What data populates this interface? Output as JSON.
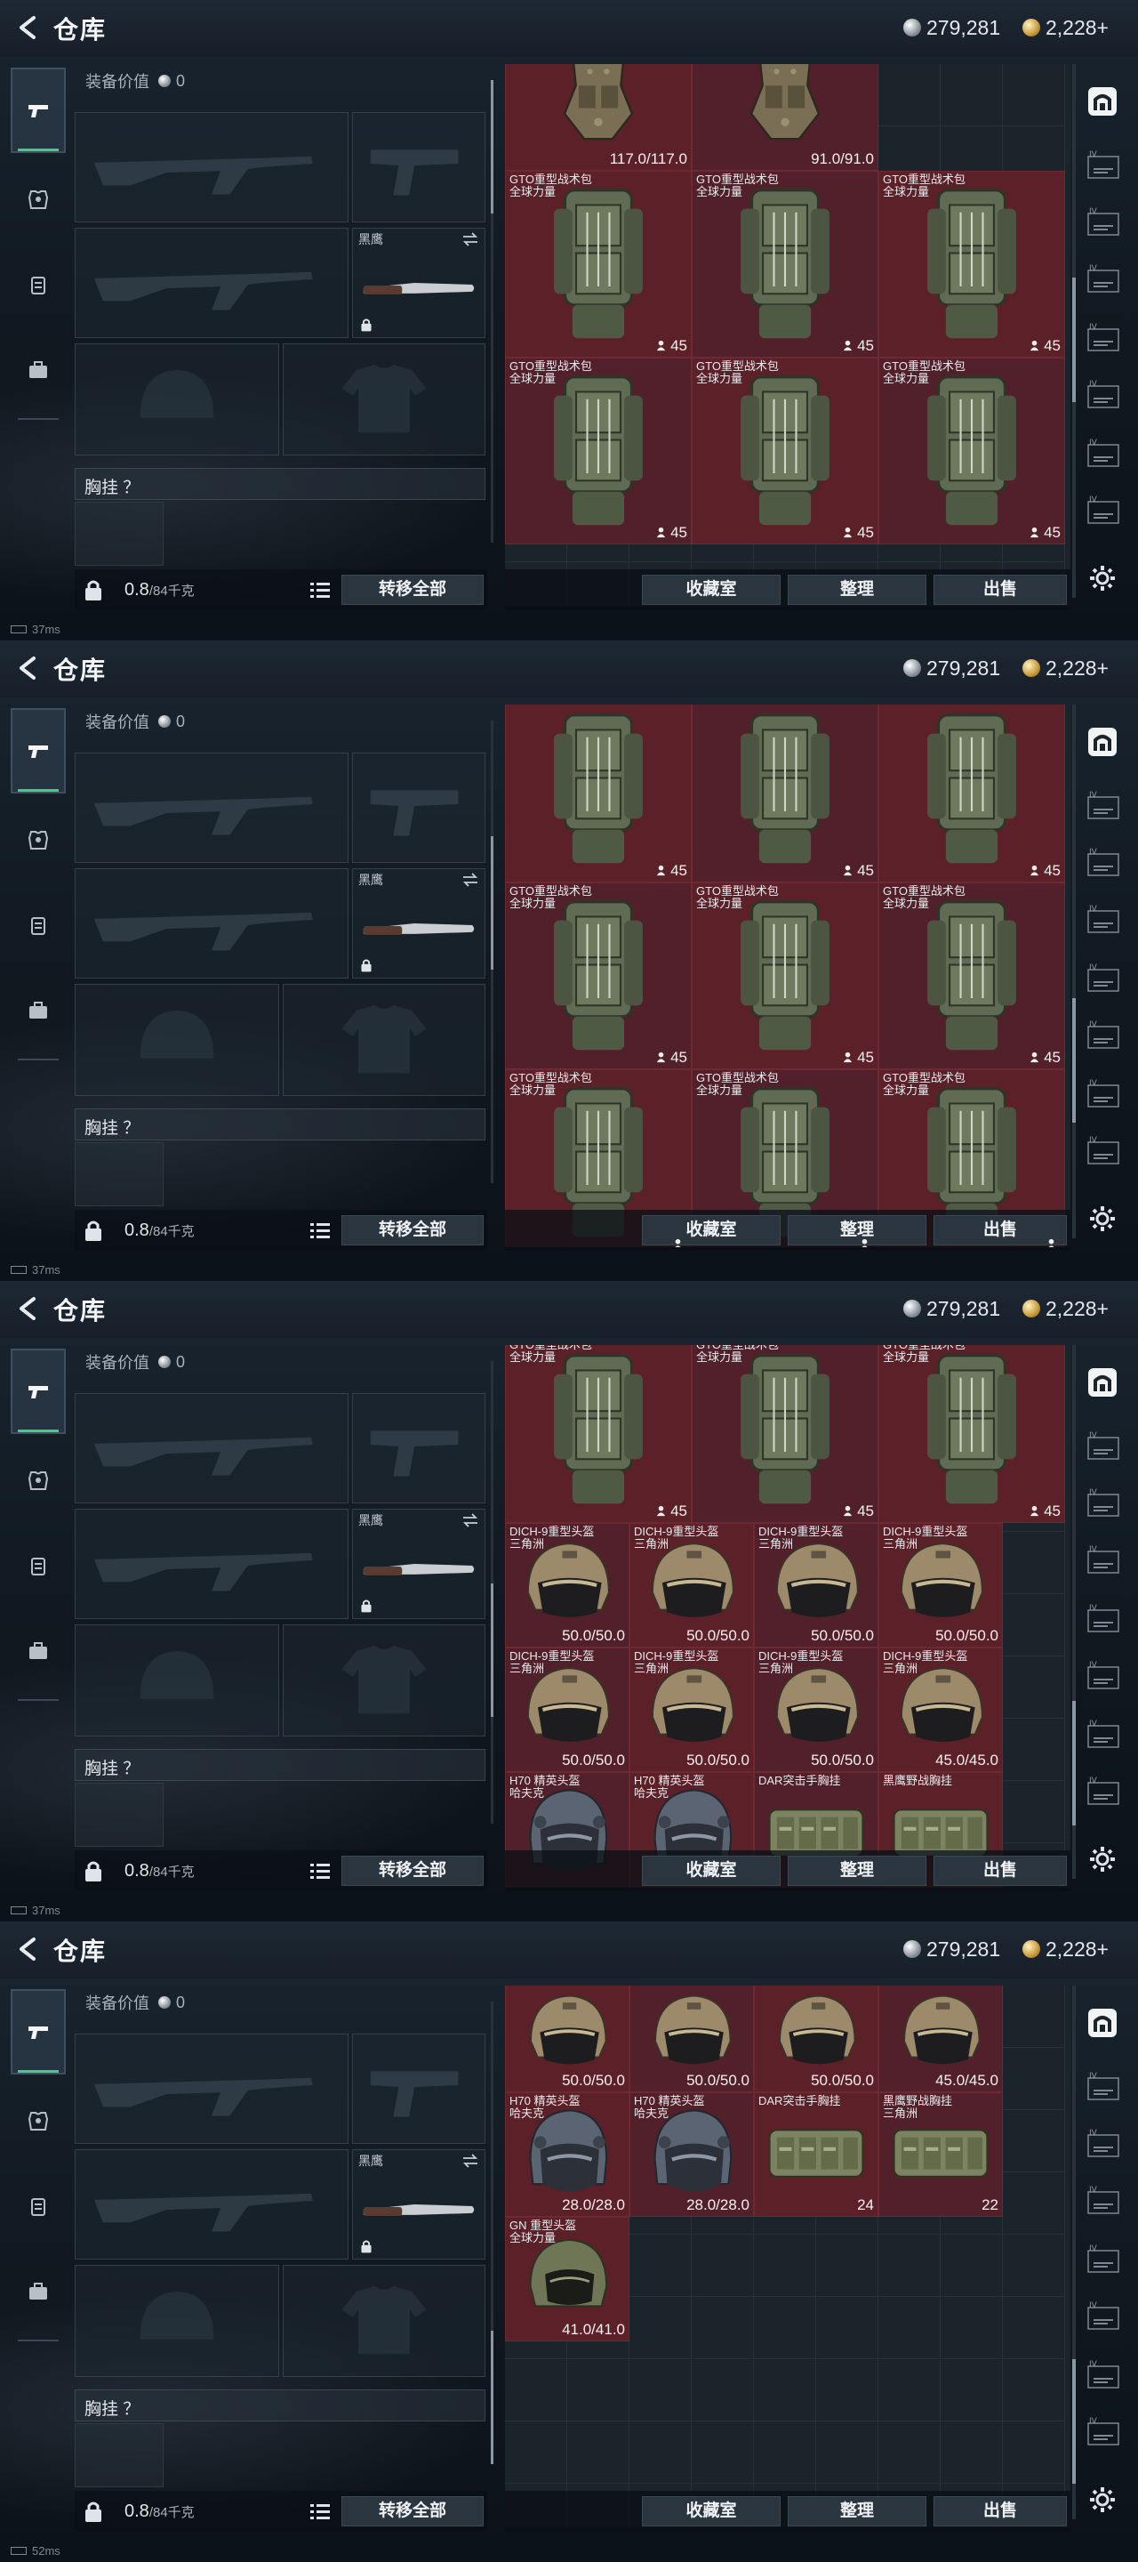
{
  "header": {
    "title": "仓库",
    "silver": "279,281",
    "gold": "2,228+"
  },
  "equipment": {
    "value_label": "装备价值",
    "value": "0",
    "knife_label": "黑鹰",
    "chest_label": "胸挂 ？"
  },
  "footer": {
    "weight": "0.8",
    "weight_max": "/84千克",
    "transfer_all": "转移全部",
    "collection": "收藏室",
    "sort": "整理",
    "sell": "出售"
  },
  "panels": [
    {
      "status": "37ms",
      "items": [
        {
          "kind": "rig",
          "name": "",
          "value": "117.0/117.0",
          "color": "red"
        },
        {
          "kind": "rig",
          "name": "",
          "value": "91.0/91.0",
          "color": "red"
        },
        {
          "kind": "bag",
          "name": "GTO重型战术包\n全球力量",
          "value": "45",
          "color": "red"
        },
        {
          "kind": "bag",
          "name": "GTO重型战术包\n全球力量",
          "value": "45",
          "color": "red"
        },
        {
          "kind": "bag",
          "name": "GTO重型战术包\n全球力量",
          "value": "45",
          "color": "red"
        },
        {
          "kind": "bag",
          "name": "GTO重型战术包\n全球力量",
          "value": "45",
          "color": "red"
        },
        {
          "kind": "bag",
          "name": "GTO重型战术包\n全球力量",
          "value": "45",
          "color": "red"
        },
        {
          "kind": "bag",
          "name": "GTO重型战术包\n全球力量",
          "value": "45",
          "color": "red"
        }
      ]
    },
    {
      "status": "37ms",
      "items": [
        {
          "kind": "bag",
          "name": "",
          "value": "45",
          "color": "red"
        },
        {
          "kind": "bag",
          "name": "",
          "value": "45",
          "color": "red"
        },
        {
          "kind": "bag",
          "name": "",
          "value": "45",
          "color": "red"
        },
        {
          "kind": "bag",
          "name": "GTO重型战术包\n全球力量",
          "value": "45",
          "color": "red"
        },
        {
          "kind": "bag",
          "name": "GTO重型战术包\n全球力量",
          "value": "45",
          "color": "red"
        },
        {
          "kind": "bag",
          "name": "GTO重型战术包\n全球力量",
          "value": "45",
          "color": "red"
        },
        {
          "kind": "bag",
          "name": "GTO重型战术包\n全球力量",
          "value": "",
          "color": "red"
        },
        {
          "kind": "bag",
          "name": "GTO重型战术包\n全球力量",
          "value": "",
          "color": "red"
        },
        {
          "kind": "bag",
          "name": "GTO重型战术包\n全球力量",
          "value": "",
          "color": "red"
        }
      ]
    },
    {
      "status": "37ms",
      "items": [
        {
          "kind": "bag",
          "name": "GTO重型战术包\n全球力量",
          "value": "45",
          "color": "red"
        },
        {
          "kind": "bag",
          "name": "GTO重型战术包\n全球力量",
          "value": "45",
          "color": "red"
        },
        {
          "kind": "bag",
          "name": "GTO重型战术包\n全球力量",
          "value": "45",
          "color": "red"
        },
        {
          "kind": "helmet",
          "name": "DICH-9重型头盔\n三角洲",
          "value": "50.0/50.0",
          "color": "red"
        },
        {
          "kind": "helmet",
          "name": "DICH-9重型头盔\n三角洲",
          "value": "50.0/50.0",
          "color": "red"
        },
        {
          "kind": "helmet",
          "name": "DICH-9重型头盔\n三角洲",
          "value": "50.0/50.0",
          "color": "red"
        },
        {
          "kind": "helmet",
          "name": "DICH-9重型头盔\n三角洲",
          "value": "50.0/50.0",
          "color": "red"
        },
        {
          "kind": "helmet",
          "name": "DICH-9重型头盔\n三角洲",
          "value": "50.0/50.0",
          "color": "red"
        },
        {
          "kind": "helmet",
          "name": "DICH-9重型头盔\n三角洲",
          "value": "50.0/50.0",
          "color": "red"
        },
        {
          "kind": "helmet",
          "name": "DICH-9重型头盔\n三角洲",
          "value": "50.0/50.0",
          "color": "red"
        },
        {
          "kind": "helmet",
          "name": "DICH-9重型头盔\n三角洲",
          "value": "45.0/45.0",
          "color": "red"
        },
        {
          "kind": "helmet2",
          "name": "H70 精英头盔\n哈夫克",
          "value": "",
          "color": "red"
        },
        {
          "kind": "helmet2",
          "name": "H70 精英头盔\n哈夫克",
          "value": "",
          "color": "red"
        },
        {
          "kind": "vest",
          "name": "DAR突击手胸挂\n",
          "value": "",
          "color": "red"
        },
        {
          "kind": "vest",
          "name": "黑鹰野战胸挂\n",
          "value": "",
          "color": "red"
        }
      ]
    },
    {
      "status": "52ms",
      "items": [
        {
          "kind": "helmet",
          "name": "",
          "value": "50.0/50.0",
          "color": "red"
        },
        {
          "kind": "helmet",
          "name": "",
          "value": "50.0/50.0",
          "color": "red"
        },
        {
          "kind": "helmet",
          "name": "",
          "value": "50.0/50.0",
          "color": "red"
        },
        {
          "kind": "helmet",
          "name": "",
          "value": "45.0/45.0",
          "color": "red"
        },
        {
          "kind": "helmet2",
          "name": "H70 精英头盔\n哈夫克",
          "value": "28.0/28.0",
          "color": "red"
        },
        {
          "kind": "helmet2",
          "name": "H70 精英头盔\n哈夫克",
          "value": "28.0/28.0",
          "color": "red"
        },
        {
          "kind": "vest",
          "name": "DAR突击手胸挂\n",
          "value": "24",
          "color": "red"
        },
        {
          "kind": "vest",
          "name": "黑鹰野战胸挂\n三角洲",
          "value": "22",
          "color": "red"
        },
        {
          "kind": "helmet3",
          "name": "GN 重型头盔\n全球力量",
          "value": "41.0/41.0",
          "color": "red"
        }
      ]
    }
  ]
}
